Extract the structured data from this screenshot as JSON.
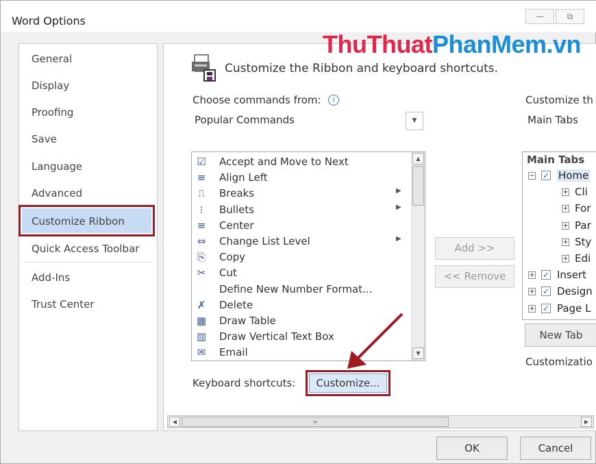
{
  "window": {
    "title": "Word Options",
    "minimize_symbol": "—",
    "restore_symbol": "⧉"
  },
  "watermark": {
    "part1": "ThuThuat",
    "part2": "PhanMem",
    "part3": ".vn"
  },
  "sidebar": {
    "items": [
      {
        "label": "General"
      },
      {
        "label": "Display"
      },
      {
        "label": "Proofing"
      },
      {
        "label": "Save"
      },
      {
        "label": "Language"
      },
      {
        "label": "Advanced"
      },
      {
        "label": "Customize Ribbon",
        "selected": true
      },
      {
        "label": "Quick Access Toolbar"
      },
      {
        "label": "Add-Ins"
      },
      {
        "label": "Trust Center"
      }
    ]
  },
  "main": {
    "header": "Customize the Ribbon and keyboard shortcuts.",
    "choose_label": "Choose commands from:",
    "choose_value": "Popular Commands",
    "customize_the_label": "Customize th",
    "customize_the_value": "Main Tabs",
    "commands": [
      {
        "label": "Accept and Move to Next",
        "icon": "accept-icon",
        "glyph": "☑"
      },
      {
        "label": "Align Left",
        "icon": "align-left-icon",
        "glyph": "≡"
      },
      {
        "label": "Breaks",
        "icon": "breaks-icon",
        "glyph": "⎍",
        "submenu": true
      },
      {
        "label": "Bullets",
        "icon": "bullets-icon",
        "glyph": "⁝",
        "submenu": true
      },
      {
        "label": "Center",
        "icon": "center-icon",
        "glyph": "≡"
      },
      {
        "label": "Change List Level",
        "icon": "change-list-level-icon",
        "glyph": "⇔",
        "submenu": true
      },
      {
        "label": "Copy",
        "icon": "copy-icon",
        "glyph": "⎘"
      },
      {
        "label": "Cut",
        "icon": "cut-icon",
        "glyph": "✂"
      },
      {
        "label": "Define New Number Format...",
        "icon": "",
        "glyph": ""
      },
      {
        "label": "Delete",
        "icon": "delete-icon",
        "glyph": "✗"
      },
      {
        "label": "Draw Table",
        "icon": "draw-table-icon",
        "glyph": "▦"
      },
      {
        "label": "Draw Vertical Text Box",
        "icon": "draw-vertical-text-box-icon",
        "glyph": "▥"
      },
      {
        "label": "Email",
        "icon": "email-icon",
        "glyph": "✉"
      }
    ],
    "add_button": "Add >>",
    "remove_button": "<< Remove",
    "keyboard_label": "Keyboard shortcuts:",
    "customize_button": "Customize...",
    "tree": {
      "header": "Main Tabs",
      "rows": [
        {
          "label": "Home",
          "expander": "⊟",
          "checked": true
        },
        {
          "label": "Cli",
          "expander": "⊞"
        },
        {
          "label": "For",
          "expander": "⊞"
        },
        {
          "label": "Par",
          "expander": "⊞"
        },
        {
          "label": "Sty",
          "expander": "⊞"
        },
        {
          "label": "Edi",
          "expander": "⊞"
        },
        {
          "label": "Insert",
          "expander": "⊞",
          "checked": true
        },
        {
          "label": "Design",
          "expander": "⊞",
          "checked": true
        },
        {
          "label": "Page L",
          "expander": "⊞",
          "checked": true
        }
      ]
    },
    "new_tab_button": "New Tab",
    "customizations_label": "Customizatio"
  },
  "footer": {
    "ok": "OK",
    "cancel": "Cancel"
  },
  "colors": {
    "highlight_box": "#9b1c24",
    "selected_bg": "#c7dcf4",
    "watermark_red": "#e0284a",
    "watermark_blue": "#1a8fd6"
  }
}
